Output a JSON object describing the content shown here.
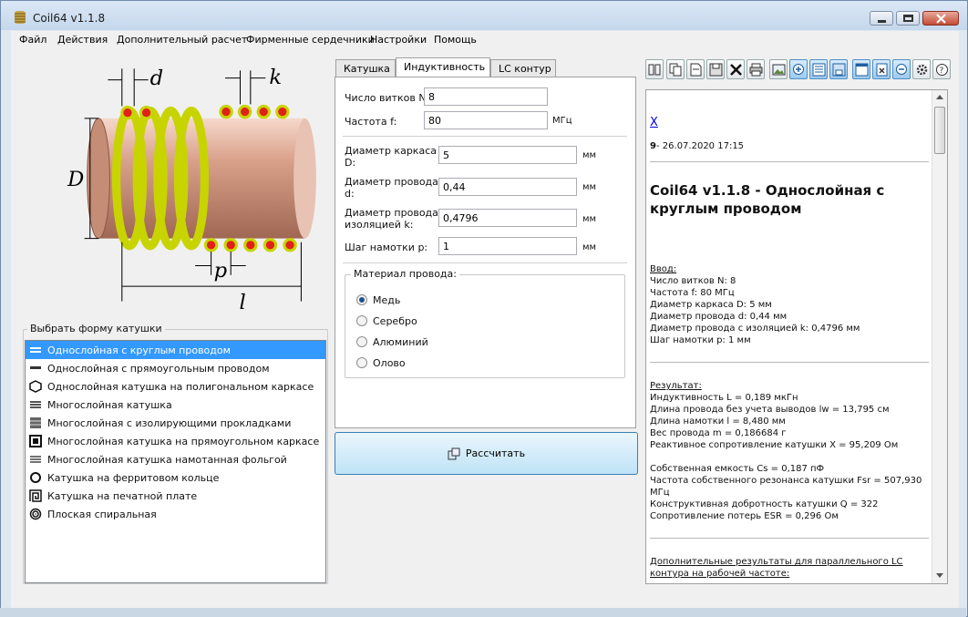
{
  "window": {
    "title": "Coil64 v1.1.8"
  },
  "menu": [
    "Файл",
    "Действия",
    "Дополнительный расчет",
    "Фирменные сердечники",
    "Настройки",
    "Помощь"
  ],
  "figure_labels": {
    "d": "d",
    "k": "k",
    "D": "D",
    "p": "p",
    "l": "l"
  },
  "shape_group": {
    "title": "Выбрать форму катушки",
    "items": [
      {
        "label": "Однослойная с круглым проводом",
        "icon": "round-wire-coil-icon",
        "selected": true
      },
      {
        "label": "Однослойная с прямоугольным проводом",
        "icon": "rect-wire-coil-icon"
      },
      {
        "label": "Однослойная катушка на полигональном каркасе",
        "icon": "polygon-former-icon"
      },
      {
        "label": "Многослойная катушка",
        "icon": "multilayer-coil-icon"
      },
      {
        "label": "Многослойная с изолирующими прокладками",
        "icon": "multilayer-gaps-icon"
      },
      {
        "label": "Многослойная катушка на прямоугольном каркасе",
        "icon": "rect-former-icon"
      },
      {
        "label": "Многослойная катушка намотанная фольгой",
        "icon": "foil-coil-icon"
      },
      {
        "label": "Катушка на ферритовом кольце",
        "icon": "ferrite-ring-icon"
      },
      {
        "label": "Катушка на печатной плате",
        "icon": "pcb-coil-icon"
      },
      {
        "label": "Плоская спиральная",
        "icon": "flat-spiral-icon"
      }
    ]
  },
  "tabs": [
    "Катушка",
    "Индуктивность",
    "LC контур"
  ],
  "form": {
    "turns": {
      "label": "Число витков N:",
      "value": "8"
    },
    "freq": {
      "label": "Частота f:",
      "value": "80",
      "unit": "МГц"
    },
    "D": {
      "label_1": "Диаметр каркаса",
      "label_2": "D:",
      "value": "5",
      "unit": "мм"
    },
    "d": {
      "label_1": "Диаметр провода",
      "label_2": "d:",
      "value": "0,44",
      "unit": "мм"
    },
    "k": {
      "label_1": "Диаметр провода с",
      "label_2": "изоляцией k:",
      "value": "0,4796",
      "unit": "мм"
    },
    "p": {
      "label": "Шаг намотки p:",
      "value": "1",
      "unit": "мм"
    }
  },
  "material": {
    "title": "Материал провода:",
    "options": [
      {
        "label": "Медь",
        "checked": true
      },
      {
        "label": "Серебро",
        "checked": false
      },
      {
        "label": "Алюминий",
        "checked": false
      },
      {
        "label": "Олово",
        "checked": false
      }
    ]
  },
  "calc_button": "Рассчитать",
  "toolbar_icons": [
    "columns-icon",
    "copy-icon",
    "document-icon",
    "save-icon",
    "delete-icon",
    "print-icon",
    "image-icon",
    "zoom-in-icon",
    "list-icon",
    "save-as-icon",
    "window-icon",
    "clear-icon",
    "zoom-out-icon",
    "settings-icon",
    "help-icon"
  ],
  "report": {
    "close_mark": "X",
    "entry_num": "9",
    "entry_date": " - 26.07.2020 17:15",
    "heading": "Coil64 v1.1.8 - Однослойная с круглым проводом",
    "input_title": "Ввод:",
    "inputs": [
      "Число витков N: 8",
      "Частота f: 80 МГц",
      "Диаметр каркаса D: 5 мм",
      "Диаметр провода d: 0,44 мм",
      "Диаметр провода с изоляцией k: 0,4796 мм",
      "Шаг намотки p: 1 мм"
    ],
    "result_title": "Результат:",
    "results": [
      "Индуктивность L = 0,189 мкГн",
      "Длина провода без учета выводов lw = 13,795 см",
      "Длина намотки l = 8,480 мм",
      "Вес провода m = 0,186684 г",
      "Реактивное сопротивление катушки X = 95,209 Ом"
    ],
    "results2": [
      "Собственная емкость Cs = 0,187 пФ",
      "Частота собственного резонанса катушки Fsr = 507,930",
      "МГц",
      "Конструктивная добротность катушки Q = 322",
      "Сопротивление потерь ESR = 0,296 Ом"
    ],
    "extra_title_1": "Дополнительные результаты для параллельного LC",
    "extra_title_2": "контура на рабочей частоте:"
  },
  "colors": {
    "accent": "#3399ff",
    "wire": "#c8d400",
    "former": "#d9a18a",
    "wire_dot": "#e0201a"
  }
}
